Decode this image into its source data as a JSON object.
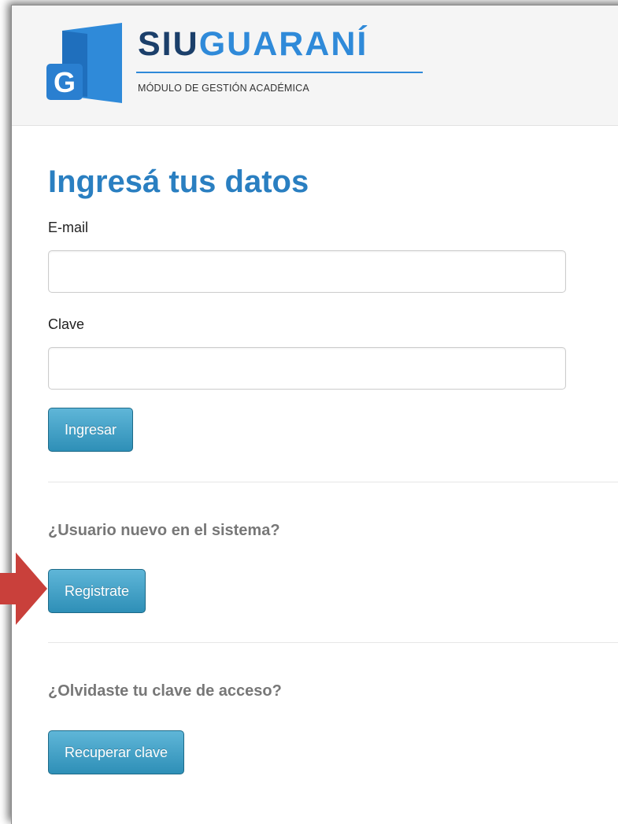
{
  "app": {
    "logo_siu": "SIU",
    "logo_guarani": "GUARANÍ",
    "logo_subtitle": "MÓDULO DE GESTIÓN ACADÉMICA",
    "logo_letter": "G"
  },
  "login": {
    "title": "Ingresá tus datos",
    "email_label": "E-mail",
    "email_value": "",
    "password_label": "Clave",
    "password_value": "",
    "submit_label": "Ingresar"
  },
  "register": {
    "heading": "¿Usuario nuevo en el sistema?",
    "button_label": "Registrate"
  },
  "recover": {
    "heading": "¿Olvidaste tu clave de acceso?",
    "button_label": "Recuperar clave"
  },
  "colors": {
    "brand_dark": "#1b3f6a",
    "brand_blue": "#2f8ad9",
    "title_blue": "#2a7fc1",
    "button_blue": "#3a9ac3",
    "annotation_arrow": "#c9403b"
  },
  "icons": {
    "logo": "siu-guarani-logo-icon",
    "annotation": "pointer-arrow-icon"
  }
}
